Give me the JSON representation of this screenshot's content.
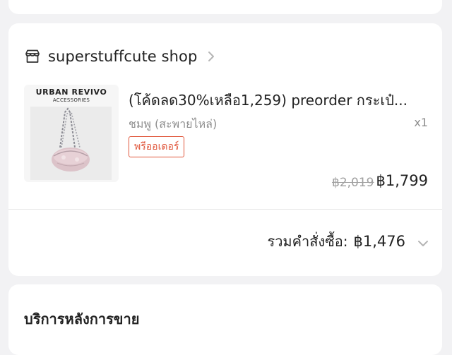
{
  "shop": {
    "name": "superstuffcute shop",
    "icon": "store-icon",
    "chevron_icon": "chevron-right-icon"
  },
  "product": {
    "thumb_brand": "URBAN REVIVO",
    "thumb_subtitle": "ACCESSORIES",
    "title": "(โค้ดลด30%เหลือ1,259) preorder กระเป๋...",
    "variant": "ชมพู (สะพายไหล่)",
    "quantity": "x1",
    "badge": "พรีออเดอร์",
    "original_price": "฿2,019",
    "price": "฿1,799"
  },
  "order_total": {
    "label": "รวมคำสั่งซื้อ:",
    "value": "฿1,476",
    "expand_icon": "chevron-down-icon"
  },
  "after_sales": {
    "title": "บริการหลังการขาย"
  },
  "colors": {
    "background": "#f2f2f4",
    "card": "#ffffff",
    "badge_accent": "#e0553a",
    "muted_text": "#8e8e8e"
  }
}
